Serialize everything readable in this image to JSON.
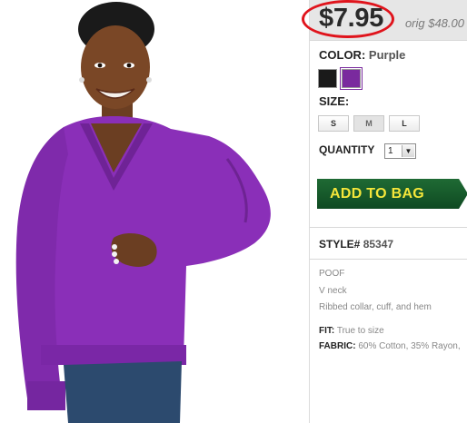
{
  "product": {
    "price": "$7.95",
    "orig_price": "orig $48.00",
    "color_label": "COLOR:",
    "color_value": "Purple",
    "swatches": [
      {
        "name": "black",
        "color": "#1a1a1a"
      },
      {
        "name": "purple",
        "color": "#7a2a9e"
      }
    ],
    "size_label": "SIZE:",
    "sizes": [
      "S",
      "M",
      "L"
    ],
    "quantity_label": "QUANTITY",
    "quantity_value": "1",
    "add_to_bag": "ADD TO BAG",
    "style_label": "STYLE#",
    "style_value": "85347",
    "description": [
      "POOF",
      "V neck",
      "Ribbed collar, cuff, and hem"
    ],
    "fit_label": "FIT:",
    "fit_value": "True to size",
    "fabric_label": "FABRIC:",
    "fabric_value": "60% Cotton, 35% Rayon,"
  },
  "colors": {
    "accent_red": "#e0141c",
    "bag_green": "#1f6a34",
    "bag_text": "#f4e63a",
    "sweater_purple": "#8a2fb8"
  }
}
